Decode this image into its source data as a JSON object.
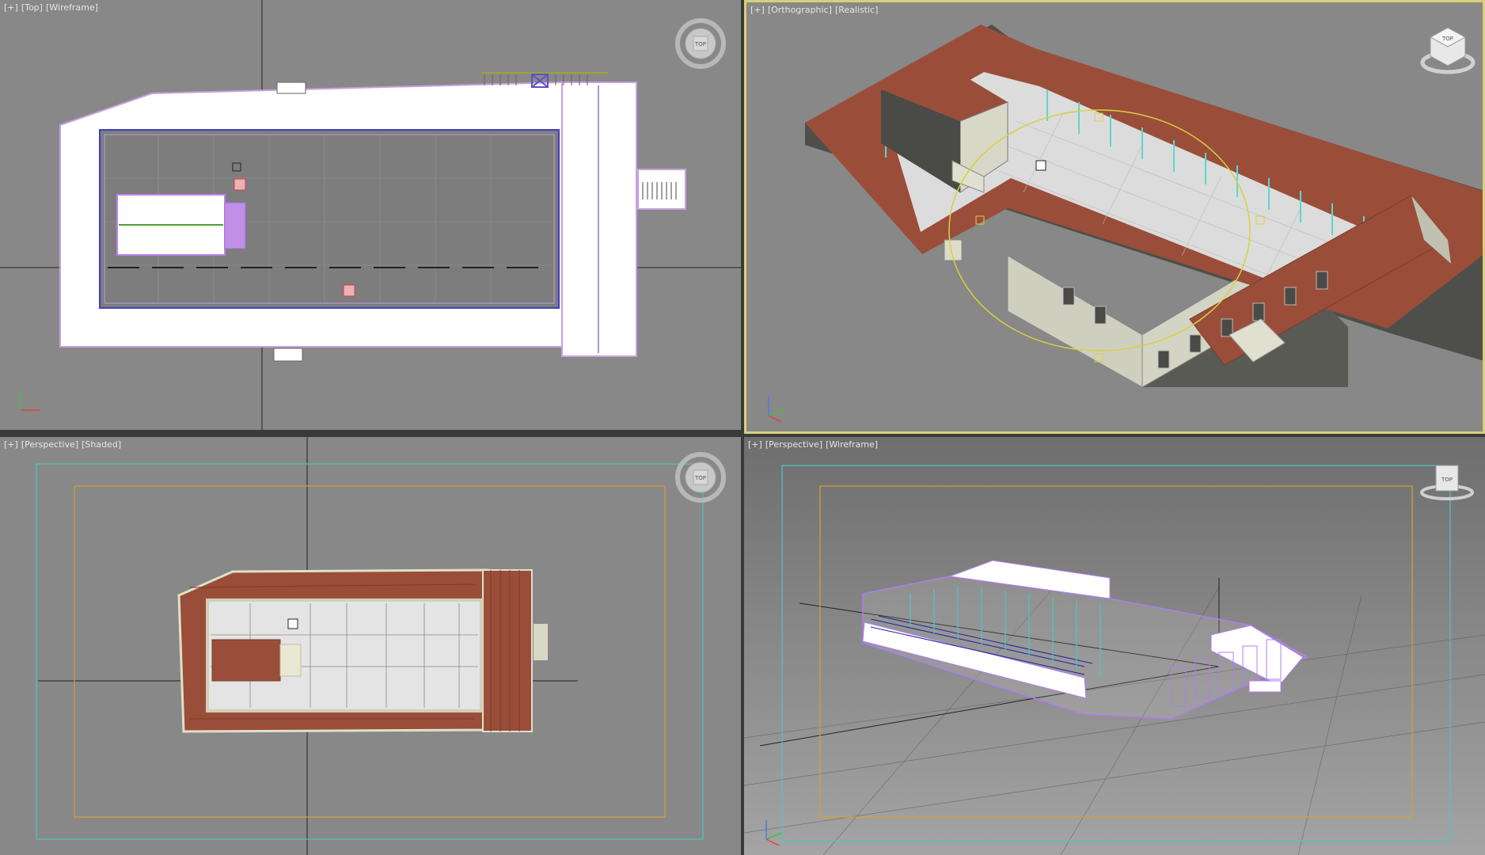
{
  "viewports": {
    "top_left": {
      "menu": "[+]",
      "view": "[Top]",
      "shading": "[Wireframe]",
      "nav_label": "TOP"
    },
    "top_right": {
      "menu": "[+]",
      "view": "[Orthographic]",
      "shading": "[Realistic]",
      "cube_label": "TOP"
    },
    "bottom_left": {
      "menu": "[+]",
      "view": "[Perspective]",
      "shading": "[Shaded]",
      "nav_label": "TOP"
    },
    "bottom_right": {
      "menu": "[+]",
      "view": "[Perspective]",
      "shading": "[Wireframe]",
      "cube_label": "TOP"
    }
  },
  "colors": {
    "viewport_bg": "#888888",
    "active_border": "#d8d078",
    "roof_tile": "#9a4e3a",
    "wall_dark": "#555550",
    "wireframe_purple": "#b07cf0",
    "safe_frame_cyan": "#4cc8c0",
    "safe_frame_orange": "#d8a030",
    "gizmo_yellow": "#d8d040"
  },
  "icons": {
    "nav_wheel": "view-cube-icon",
    "axis": "axis-tripod-icon"
  }
}
